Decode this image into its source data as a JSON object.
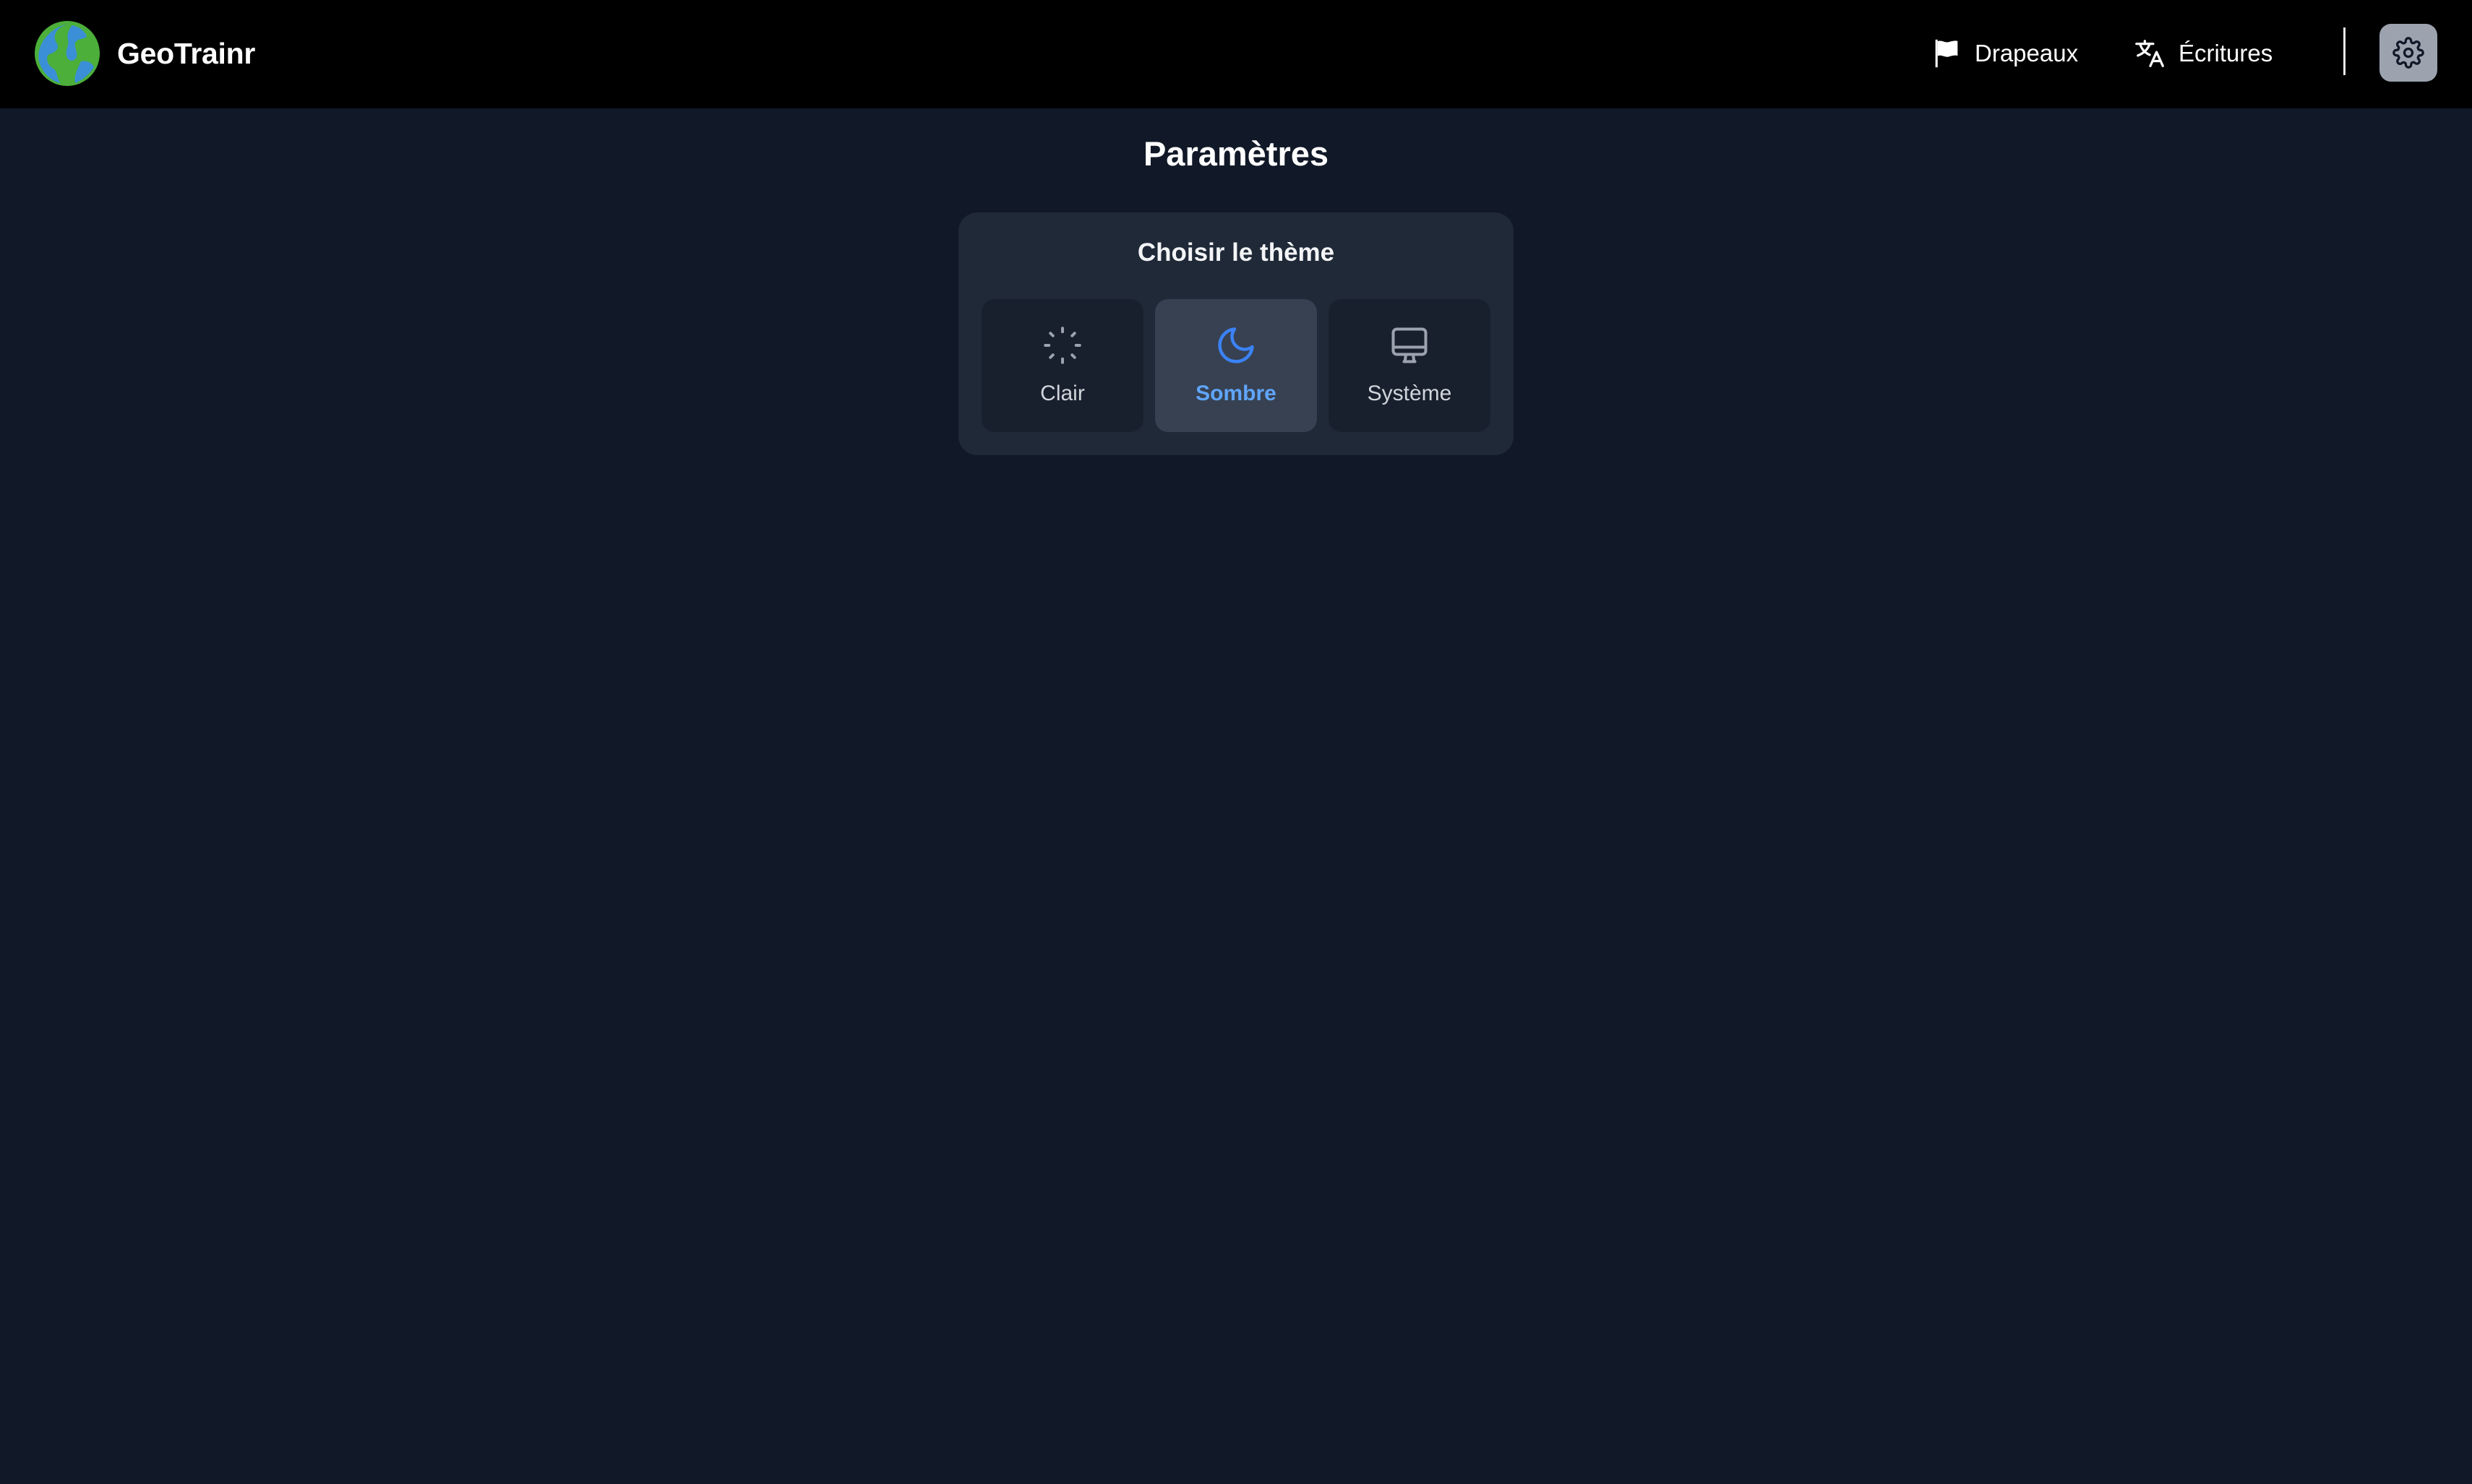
{
  "app": {
    "name": "GeoTrainr",
    "logo_icon": "globe-logo-icon"
  },
  "header": {
    "nav": [
      {
        "label": "Drapeaux",
        "icon": "flag-icon"
      },
      {
        "label": "Écritures",
        "icon": "translate-icon"
      }
    ],
    "settings_icon": "gear-icon"
  },
  "page": {
    "title": "Paramètres"
  },
  "theme": {
    "heading": "Choisir le thème",
    "selected": "Sombre",
    "options": [
      {
        "label": "Clair",
        "icon": "loader-sun-icon"
      },
      {
        "label": "Sombre",
        "icon": "moon-icon"
      },
      {
        "label": "Système",
        "icon": "monitor-icon"
      }
    ]
  },
  "colors": {
    "background": "#111827",
    "header": "#000000",
    "card": "#1f2937",
    "selected_option": "#374151",
    "accent": "#60a5fa",
    "settings_button": "#9ca3af"
  }
}
